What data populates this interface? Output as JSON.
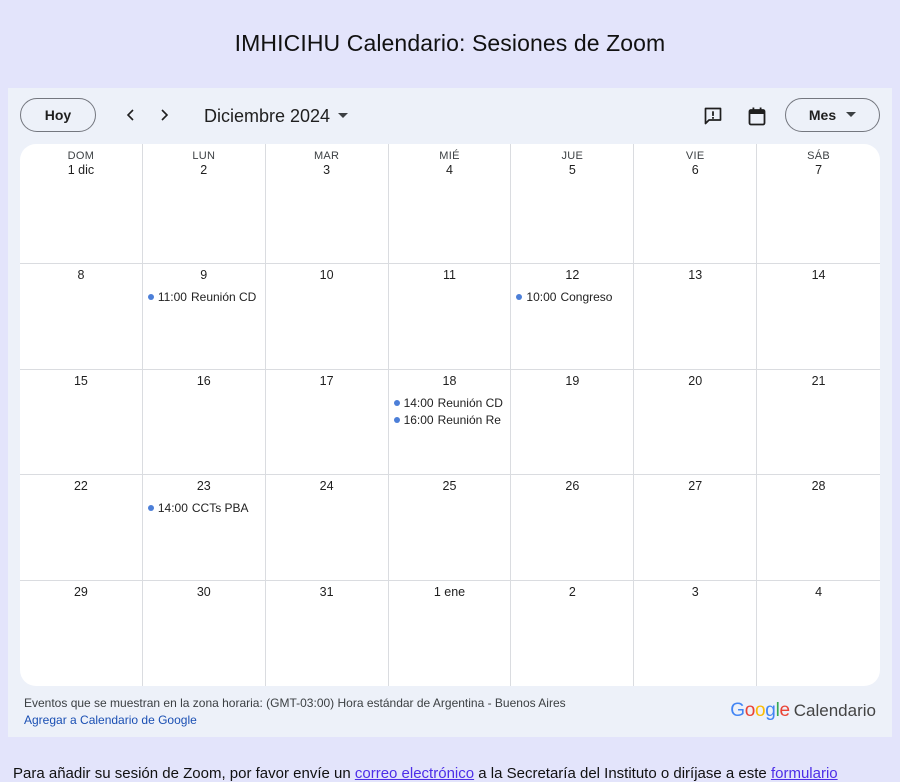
{
  "page_title": "IMHICIHU Calendario: Sesiones de Zoom",
  "toolbar": {
    "today_label": "Hoy",
    "month_label": "Diciembre 2024",
    "view_label": "Mes"
  },
  "weekdays": [
    "DOM",
    "LUN",
    "MAR",
    "MIÉ",
    "JUE",
    "VIE",
    "SÁB"
  ],
  "weeks": [
    [
      {
        "day": "1 dic"
      },
      {
        "day": "2"
      },
      {
        "day": "3"
      },
      {
        "day": "4"
      },
      {
        "day": "5"
      },
      {
        "day": "6"
      },
      {
        "day": "7"
      }
    ],
    [
      {
        "day": "8"
      },
      {
        "day": "9",
        "events": [
          {
            "time": "11:00",
            "title": "Reunión CD"
          }
        ]
      },
      {
        "day": "10"
      },
      {
        "day": "11"
      },
      {
        "day": "12",
        "events": [
          {
            "time": "10:00",
            "title": "Congreso"
          }
        ]
      },
      {
        "day": "13"
      },
      {
        "day": "14"
      }
    ],
    [
      {
        "day": "15"
      },
      {
        "day": "16"
      },
      {
        "day": "17"
      },
      {
        "day": "18",
        "events": [
          {
            "time": "14:00",
            "title": "Reunión CD"
          },
          {
            "time": "16:00",
            "title": "Reunión Re"
          }
        ]
      },
      {
        "day": "19"
      },
      {
        "day": "20"
      },
      {
        "day": "21"
      }
    ],
    [
      {
        "day": "22"
      },
      {
        "day": "23",
        "events": [
          {
            "time": "14:00",
            "title": "CCTs PBA"
          }
        ]
      },
      {
        "day": "24"
      },
      {
        "day": "25"
      },
      {
        "day": "26"
      },
      {
        "day": "27"
      },
      {
        "day": "28"
      }
    ],
    [
      {
        "day": "29"
      },
      {
        "day": "30"
      },
      {
        "day": "31"
      },
      {
        "day": "1 ene"
      },
      {
        "day": "2"
      },
      {
        "day": "3"
      },
      {
        "day": "4"
      }
    ]
  ],
  "footer": {
    "timezone_text": "Eventos que se muestran en la zona horaria: (GMT-03:00) Hora estándar de Argentina - Buenos Aires",
    "add_link": "Agregar a Calendario de Google",
    "brand_product": "Calendario"
  },
  "bottom": {
    "text_1": "Para añadir su sesión de Zoom, por favor envíe un ",
    "link_1": "correo electrónico",
    "text_2": " a la Secretaría del Instituto o diríjase a este ",
    "link_2": "formulario"
  },
  "colors": {
    "page_bg": "#e3e4fb",
    "frame_bg": "#edf1f9",
    "event_dot": "#4c7fd8",
    "link": "#1a4fb3"
  },
  "icons": {
    "prev": "chevron-left-icon",
    "next": "chevron-right-icon",
    "month_dropdown": "caret-down-icon",
    "feedback": "feedback-icon",
    "calendar": "calendar-icon",
    "view_dropdown": "caret-down-icon"
  }
}
